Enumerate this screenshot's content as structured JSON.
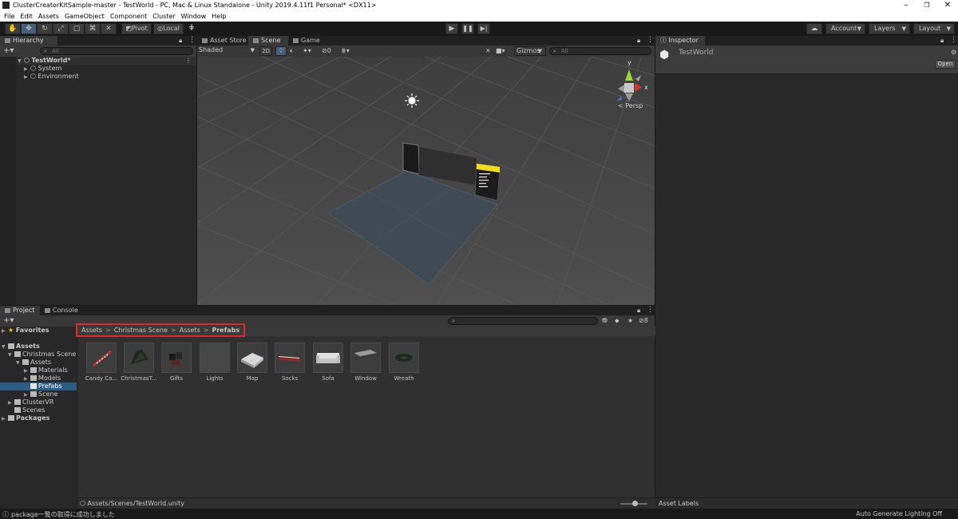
{
  "window": {
    "title": "ClusterCreatorKitSample-master - TestWorld - PC, Mac & Linux Standalone - Unity 2019.4.11f1 Personal* <DX11>"
  },
  "menu": [
    "File",
    "Edit",
    "Assets",
    "GameObject",
    "Component",
    "Cluster",
    "Window",
    "Help"
  ],
  "toolbar": {
    "pivot_label": "Pivot",
    "local_label": "Local",
    "account_label": "Account",
    "layers_label": "Layers",
    "layout_label": "Layout"
  },
  "hierarchy": {
    "tab_label": "Hierarchy",
    "search_placeholder": "All",
    "scene_name": "TestWorld*",
    "items": [
      "System",
      "Environment"
    ]
  },
  "scene_view": {
    "tabs": [
      "Asset Store",
      "Scene",
      "Game"
    ],
    "shading_mode": "Shaded",
    "mode_2d": "2D",
    "fx_count": "0",
    "gizmos_label": "Gizmos",
    "search_placeholder": "All",
    "persp_label": "Persp",
    "axis_labels": {
      "y": "y",
      "x": "x"
    }
  },
  "inspector": {
    "tab_label": "Inspector",
    "object_name": "TestWorld",
    "open_button": "Open",
    "asset_labels": "Asset Labels"
  },
  "project": {
    "tabs": [
      "Project",
      "Console"
    ],
    "breadcrumb": [
      "Assets",
      "Christmas Scene",
      "Assets",
      "Prefabs"
    ],
    "favorites_label": "Favorites",
    "tree": [
      {
        "label": "Assets",
        "level": 0,
        "bold": true
      },
      {
        "label": "Christmas Scene",
        "level": 1
      },
      {
        "label": "Assets",
        "level": 2
      },
      {
        "label": "Materials",
        "level": 3
      },
      {
        "label": "Models",
        "level": 3
      },
      {
        "label": "Prefabs",
        "level": 3,
        "selected": true
      },
      {
        "label": "Scene",
        "level": 3
      },
      {
        "label": "ClusterVR",
        "level": 1
      },
      {
        "label": "Scenes",
        "level": 1
      },
      {
        "label": "Packages",
        "level": 0,
        "bold": true
      }
    ],
    "assets": [
      "Candy Ca...",
      "ChristmasT...",
      "Gifts",
      "Lights",
      "Map",
      "Socks",
      "Sofa",
      "Window",
      "Wreath"
    ],
    "hidden_count": "8",
    "footer_path": "Assets/Scenes/TestWorld.unity"
  },
  "statusbar": {
    "message": "package一覧の取得に成功しました",
    "right_text": "Auto Generate Lighting Off"
  },
  "colors": {
    "accent_selection": "#2c5d87",
    "breadcrumb_highlight": "#e0262b"
  }
}
